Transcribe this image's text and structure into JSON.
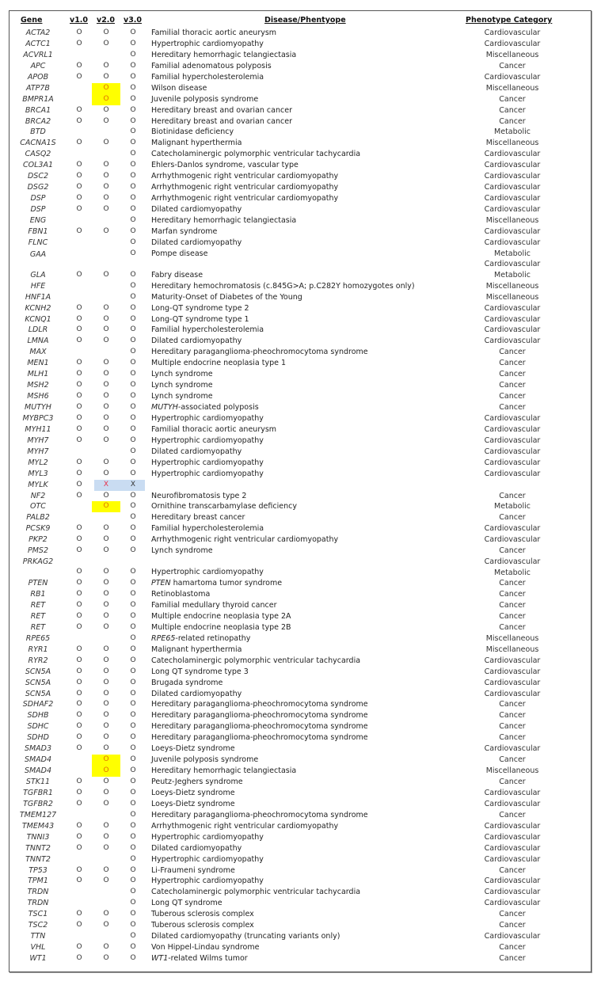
{
  "headers": {
    "gene": "Gene",
    "v1": "v1.0",
    "v2": "v2.0",
    "v3": "v3.0",
    "disease": "Disease/Phentyope",
    "category": "Phenotype Category"
  },
  "legend": {
    "mark_included": "O",
    "mark_removed": "X",
    "highlight_yellow": "#ffff00",
    "highlight_blue": "#c9dcf2"
  },
  "rows": [
    {
      "gene": "ACTA2",
      "v1": "O",
      "v2": "O",
      "v3": "O",
      "disease": "Familial thoracic aortic aneurysm",
      "category": "Cardiovascular"
    },
    {
      "gene": "ACTC1",
      "v1": "O",
      "v2": "O",
      "v3": "O",
      "disease": "Hypertrophic cardiomyopathy",
      "category": "Cardiovascular"
    },
    {
      "gene": "ACVRL1",
      "v1": "",
      "v2": "",
      "v3": "O",
      "disease": "Hereditary hemorrhagic telangiectasia",
      "category": "Miscellaneous"
    },
    {
      "gene": "APC",
      "v1": "O",
      "v2": "O",
      "v3": "O",
      "disease": "Familial adenomatous polyposis",
      "category": "Cancer"
    },
    {
      "gene": "APOB",
      "v1": "O",
      "v2": "O",
      "v3": "O",
      "disease": "Familial hypercholesterolemia",
      "category": "Cardiovascular"
    },
    {
      "gene": "ATP7B",
      "v1": "",
      "v2": "O",
      "v3": "O",
      "disease": "Wilson disease",
      "category": "Miscellaneous",
      "v2_highlight": "yellow"
    },
    {
      "gene": "BMPR1A",
      "v1": "",
      "v2": "O",
      "v3": "O",
      "disease": "Juvenile polyposis syndrome",
      "category": "Cancer",
      "v2_highlight": "yellow"
    },
    {
      "gene": "BRCA1",
      "v1": "O",
      "v2": "O",
      "v3": "O",
      "disease": "Hereditary breast and ovarian cancer",
      "category": "Cancer"
    },
    {
      "gene": "BRCA2",
      "v1": "O",
      "v2": "O",
      "v3": "O",
      "disease": "Hereditary breast and ovarian cancer",
      "category": "Cancer"
    },
    {
      "gene": "BTD",
      "v1": "",
      "v2": "",
      "v3": "O",
      "disease": "Biotinidase deficiency",
      "category": "Metabolic"
    },
    {
      "gene": "CACNA1S",
      "v1": "O",
      "v2": "O",
      "v3": "O",
      "disease": "Malignant hyperthermia",
      "category": "Miscellaneous"
    },
    {
      "gene": "CASQ2",
      "v1": "",
      "v2": "",
      "v3": "O",
      "disease": "Catecholaminergic polymorphic ventricular tachycardia",
      "category": "Cardiovascular"
    },
    {
      "gene": "COL3A1",
      "v1": "O",
      "v2": "O",
      "v3": "O",
      "disease": "Ehlers-Danlos syndrome, vascular type",
      "category": "Cardiovascular"
    },
    {
      "gene": "DSC2",
      "v1": "O",
      "v2": "O",
      "v3": "O",
      "disease": "Arrhythmogenic right ventricular cardiomyopathy",
      "category": "Cardiovascular"
    },
    {
      "gene": "DSG2",
      "v1": "O",
      "v2": "O",
      "v3": "O",
      "disease": "Arrhythmogenic right ventricular cardiomyopathy",
      "category": "Cardiovascular"
    },
    {
      "gene": "DSP",
      "v1": "O",
      "v2": "O",
      "v3": "O",
      "disease": "Arrhythmogenic right ventricular cardiomyopathy",
      "category": "Cardiovascular"
    },
    {
      "gene": "DSP",
      "v1": "O",
      "v2": "O",
      "v3": "O",
      "disease": "Dilated cardiomyopathy",
      "category": "Cardiovascular"
    },
    {
      "gene": "ENG",
      "v1": "",
      "v2": "",
      "v3": "O",
      "disease": "Hereditary hemorrhagic telangiectasia",
      "category": "Miscellaneous"
    },
    {
      "gene": "FBN1",
      "v1": "O",
      "v2": "O",
      "v3": "O",
      "disease": "Marfan syndrome",
      "category": "Cardiovascular"
    },
    {
      "gene": "FLNC",
      "v1": "",
      "v2": "",
      "v3": "O",
      "disease": "Dilated cardiomyopathy",
      "category": "Cardiovascular"
    },
    {
      "gene": "GAA",
      "v1": "",
      "v2": "",
      "v3": "O",
      "disease": "Pompe disease",
      "category": "Metabolic\nCardiovascular",
      "tall": "gaa"
    },
    {
      "gene": "GLA",
      "v1": "O",
      "v2": "O",
      "v3": "O",
      "disease": "Fabry disease",
      "category": "Metabolic"
    },
    {
      "gene": "HFE",
      "v1": "",
      "v2": "",
      "v3": "O",
      "disease": "Hereditary hemochromatosis (c.845G>A; p.C282Y homozygotes only)",
      "category": "Miscellaneous"
    },
    {
      "gene": "HNF1A",
      "v1": "",
      "v2": "",
      "v3": "O",
      "disease": "Maturity-Onset of Diabetes of the Young",
      "category": "Miscellaneous"
    },
    {
      "gene": "KCNH2",
      "v1": "O",
      "v2": "O",
      "v3": "O",
      "disease": "Long-QT syndrome type 2",
      "category": "Cardiovascular"
    },
    {
      "gene": "KCNQ1",
      "v1": "O",
      "v2": "O",
      "v3": "O",
      "disease": "Long-QT syndrome type 1",
      "category": "Cardiovascular"
    },
    {
      "gene": "LDLR",
      "v1": "O",
      "v2": "O",
      "v3": "O",
      "disease": "Familial hypercholesterolemia",
      "category": "Cardiovascular"
    },
    {
      "gene": "LMNA",
      "v1": "O",
      "v2": "O",
      "v3": "O",
      "disease": "Dilated cardiomyopathy",
      "category": "Cardiovascular"
    },
    {
      "gene": "MAX",
      "v1": "",
      "v2": "",
      "v3": "O",
      "disease": "Hereditary paraganglioma-pheochromocytoma syndrome",
      "category": "Cancer"
    },
    {
      "gene": "MEN1",
      "v1": "O",
      "v2": "O",
      "v3": "O",
      "disease": "Multiple endocrine neoplasia type 1",
      "category": "Cancer"
    },
    {
      "gene": "MLH1",
      "v1": "O",
      "v2": "O",
      "v3": "O",
      "disease": "Lynch syndrome",
      "category": "Cancer"
    },
    {
      "gene": "MSH2",
      "v1": "O",
      "v2": "O",
      "v3": "O",
      "disease": "Lynch syndrome",
      "category": "Cancer"
    },
    {
      "gene": "MSH6",
      "v1": "O",
      "v2": "O",
      "v3": "O",
      "disease": "Lynch syndrome",
      "category": "Cancer"
    },
    {
      "gene": "MUTYH",
      "v1": "O",
      "v2": "O",
      "v3": "O",
      "disease_italic": "MUTYH",
      "disease": "-associated polyposis",
      "category": "Cancer"
    },
    {
      "gene": "MYBPC3",
      "v1": "O",
      "v2": "O",
      "v3": "O",
      "disease": "Hypertrophic cardiomyopathy",
      "category": "Cardiovascular"
    },
    {
      "gene": "MYH11",
      "v1": "O",
      "v2": "O",
      "v3": "O",
      "disease": "Familial thoracic aortic aneurysm",
      "category": "Cardiovascular"
    },
    {
      "gene": "MYH7",
      "v1": "O",
      "v2": "O",
      "v3": "O",
      "disease": "Hypertrophic cardiomyopathy",
      "category": "Cardiovascular"
    },
    {
      "gene": "MYH7",
      "v1": "",
      "v2": "",
      "v3": "O",
      "disease": "Dilated cardiomyopathy",
      "category": "Cardiovascular"
    },
    {
      "gene": "MYL2",
      "v1": "O",
      "v2": "O",
      "v3": "O",
      "disease": "Hypertrophic cardiomyopathy",
      "category": "Cardiovascular"
    },
    {
      "gene": "MYL3",
      "v1": "O",
      "v2": "O",
      "v3": "O",
      "disease": "Hypertrophic cardiomyopathy",
      "category": "Cardiovascular"
    },
    {
      "gene": "MYLK",
      "v1": "O",
      "v2": "X",
      "v3": "X",
      "disease": "",
      "category": "",
      "removed": true
    },
    {
      "gene": "NF2",
      "v1": "O",
      "v2": "O",
      "v3": "O",
      "disease": "Neurofibromatosis type 2",
      "category": "Cancer"
    },
    {
      "gene": "OTC",
      "v1": "",
      "v2": "O",
      "v3": "O",
      "disease": "Ornithine transcarbamylase deficiency",
      "category": "Metabolic",
      "v2_highlight": "yellow"
    },
    {
      "gene": "PALB2",
      "v1": "",
      "v2": "",
      "v3": "O",
      "disease": "Hereditary breast cancer",
      "category": "Cancer"
    },
    {
      "gene": "PCSK9",
      "v1": "O",
      "v2": "O",
      "v3": "O",
      "disease": "Familial hypercholesterolemia",
      "category": "Cardiovascular"
    },
    {
      "gene": "PKP2",
      "v1": "O",
      "v2": "O",
      "v3": "O",
      "disease": "Arrhythmogenic right ventricular cardiomyopathy",
      "category": "Cardiovascular"
    },
    {
      "gene": "PMS2",
      "v1": "O",
      "v2": "O",
      "v3": "O",
      "disease": "Lynch syndrome",
      "category": "Cancer"
    },
    {
      "gene": "PRKAG2",
      "v1": "O",
      "v2": "O",
      "v3": "O",
      "disease": "Hypertrophic cardiomyopathy",
      "category": "Cardiovascular\nMetabolic",
      "tall": "prkag2"
    },
    {
      "gene": "PTEN",
      "v1": "O",
      "v2": "O",
      "v3": "O",
      "disease_italic": "PTEN",
      "disease": " hamartoma tumor syndrome",
      "category": "Cancer"
    },
    {
      "gene": "RB1",
      "v1": "O",
      "v2": "O",
      "v3": "O",
      "disease": "Retinoblastoma",
      "category": "Cancer"
    },
    {
      "gene": "RET",
      "v1": "O",
      "v2": "O",
      "v3": "O",
      "disease": "Familial medullary thyroid cancer",
      "category": "Cancer"
    },
    {
      "gene": "RET",
      "v1": "O",
      "v2": "O",
      "v3": "O",
      "disease": "Multiple endocrine neoplasia type 2A",
      "category": "Cancer"
    },
    {
      "gene": "RET",
      "v1": "O",
      "v2": "O",
      "v3": "O",
      "disease": "Multiple endocrine neoplasia type 2B",
      "category": "Cancer"
    },
    {
      "gene": "RPE65",
      "v1": "",
      "v2": "",
      "v3": "O",
      "disease_italic": "RPE65",
      "disease": "-related retinopathy",
      "category": "Miscellaneous"
    },
    {
      "gene": "RYR1",
      "v1": "O",
      "v2": "O",
      "v3": "O",
      "disease": "Malignant hyperthermia",
      "category": "Miscellaneous"
    },
    {
      "gene": "RYR2",
      "v1": "O",
      "v2": "O",
      "v3": "O",
      "disease": "Catecholaminergic polymorphic ventricular tachycardia",
      "category": "Cardiovascular"
    },
    {
      "gene": "SCN5A",
      "v1": "O",
      "v2": "O",
      "v3": "O",
      "disease": "Long QT syndrome type 3",
      "category": "Cardiovascular"
    },
    {
      "gene": "SCN5A",
      "v1": "O",
      "v2": "O",
      "v3": "O",
      "disease": "Brugada syndrome",
      "category": "Cardiovascular"
    },
    {
      "gene": "SCN5A",
      "v1": "O",
      "v2": "O",
      "v3": "O",
      "disease": "Dilated cardiomyopathy",
      "category": "Cardiovascular"
    },
    {
      "gene": "SDHAF2",
      "v1": "O",
      "v2": "O",
      "v3": "O",
      "disease": "Hereditary paraganglioma-pheochromocytoma syndrome",
      "category": "Cancer"
    },
    {
      "gene": "SDHB",
      "v1": "O",
      "v2": "O",
      "v3": "O",
      "disease": "Hereditary paraganglioma-pheochromocytoma syndrome",
      "category": "Cancer"
    },
    {
      "gene": "SDHC",
      "v1": "O",
      "v2": "O",
      "v3": "O",
      "disease": "Hereditary paraganglioma-pheochromocytoma syndrome",
      "category": "Cancer"
    },
    {
      "gene": "SDHD",
      "v1": "O",
      "v2": "O",
      "v3": "O",
      "disease": "Hereditary paraganglioma-pheochromocytoma syndrome",
      "category": "Cancer"
    },
    {
      "gene": "SMAD3",
      "v1": "O",
      "v2": "O",
      "v3": "O",
      "disease": "Loeys-Dietz syndrome",
      "category": "Cardiovascular"
    },
    {
      "gene": "SMAD4",
      "v1": "",
      "v2": "O",
      "v3": "O",
      "disease": "Juvenile polyposis syndrome",
      "category": "Cancer",
      "v2_highlight": "yellow"
    },
    {
      "gene": "SMAD4",
      "v1": "",
      "v2": "O",
      "v3": "O",
      "disease": "Hereditary hemorrhagic telangiectasia",
      "category": "Miscellaneous",
      "v2_highlight": "yellow"
    },
    {
      "gene": "STK11",
      "v1": "O",
      "v2": "O",
      "v3": "O",
      "disease": "Peutz-Jeghers syndrome",
      "category": "Cancer"
    },
    {
      "gene": "TGFBR1",
      "v1": "O",
      "v2": "O",
      "v3": "O",
      "disease": "Loeys-Dietz syndrome",
      "category": "Cardiovascular"
    },
    {
      "gene": "TGFBR2",
      "v1": "O",
      "v2": "O",
      "v3": "O",
      "disease": "Loeys-Dietz syndrome",
      "category": "Cardiovascular"
    },
    {
      "gene": "TMEM127",
      "v1": "",
      "v2": "",
      "v3": "O",
      "disease": "Hereditary paraganglioma-pheochromocytoma syndrome",
      "category": "Cancer"
    },
    {
      "gene": "TMEM43",
      "v1": "O",
      "v2": "O",
      "v3": "O",
      "disease": "Arrhythmogenic right ventricular cardiomyopathy",
      "category": "Cardiovascular"
    },
    {
      "gene": "TNNI3",
      "v1": "O",
      "v2": "O",
      "v3": "O",
      "disease": "Hypertrophic cardiomyopathy",
      "category": "Cardiovascular"
    },
    {
      "gene": "TNNT2",
      "v1": "O",
      "v2": "O",
      "v3": "O",
      "disease": "Dilated cardiomyopathy",
      "category": "Cardiovascular"
    },
    {
      "gene": "TNNT2",
      "v1": "",
      "v2": "",
      "v3": "O",
      "disease": "Hypertrophic cardiomyopathy",
      "category": "Cardiovascular"
    },
    {
      "gene": "TP53",
      "v1": "O",
      "v2": "O",
      "v3": "O",
      "disease": "Li-Fraumeni syndrome",
      "category": "Cancer"
    },
    {
      "gene": "TPM1",
      "v1": "O",
      "v2": "O",
      "v3": "O",
      "disease": "Hypertrophic cardiomyopathy",
      "category": "Cardiovascular"
    },
    {
      "gene": "TRDN",
      "v1": "",
      "v2": "",
      "v3": "O",
      "disease": "Catecholaminergic polymorphic ventricular tachycardia",
      "category": "Cardiovascular"
    },
    {
      "gene": "TRDN",
      "v1": "",
      "v2": "",
      "v3": "O",
      "disease": "Long QT syndrome",
      "category": "Cardiovascular"
    },
    {
      "gene": "TSC1",
      "v1": "O",
      "v2": "O",
      "v3": "O",
      "disease": "Tuberous sclerosis complex",
      "category": "Cancer"
    },
    {
      "gene": "TSC2",
      "v1": "O",
      "v2": "O",
      "v3": "O",
      "disease": "Tuberous sclerosis complex",
      "category": "Cancer"
    },
    {
      "gene": "TTN",
      "v1": "",
      "v2": "",
      "v3": "O",
      "disease": "Dilated cardiomyopathy (truncating variants only)",
      "category": "Cardiovascular"
    },
    {
      "gene": "VHL",
      "v1": "O",
      "v2": "O",
      "v3": "O",
      "disease": "Von Hippel-Lindau syndrome",
      "category": "Cancer"
    },
    {
      "gene": "WT1",
      "v1": "O",
      "v2": "O",
      "v3": "O",
      "disease_italic": "WT1",
      "disease": "-related Wilms tumor",
      "category": "Cancer"
    }
  ]
}
